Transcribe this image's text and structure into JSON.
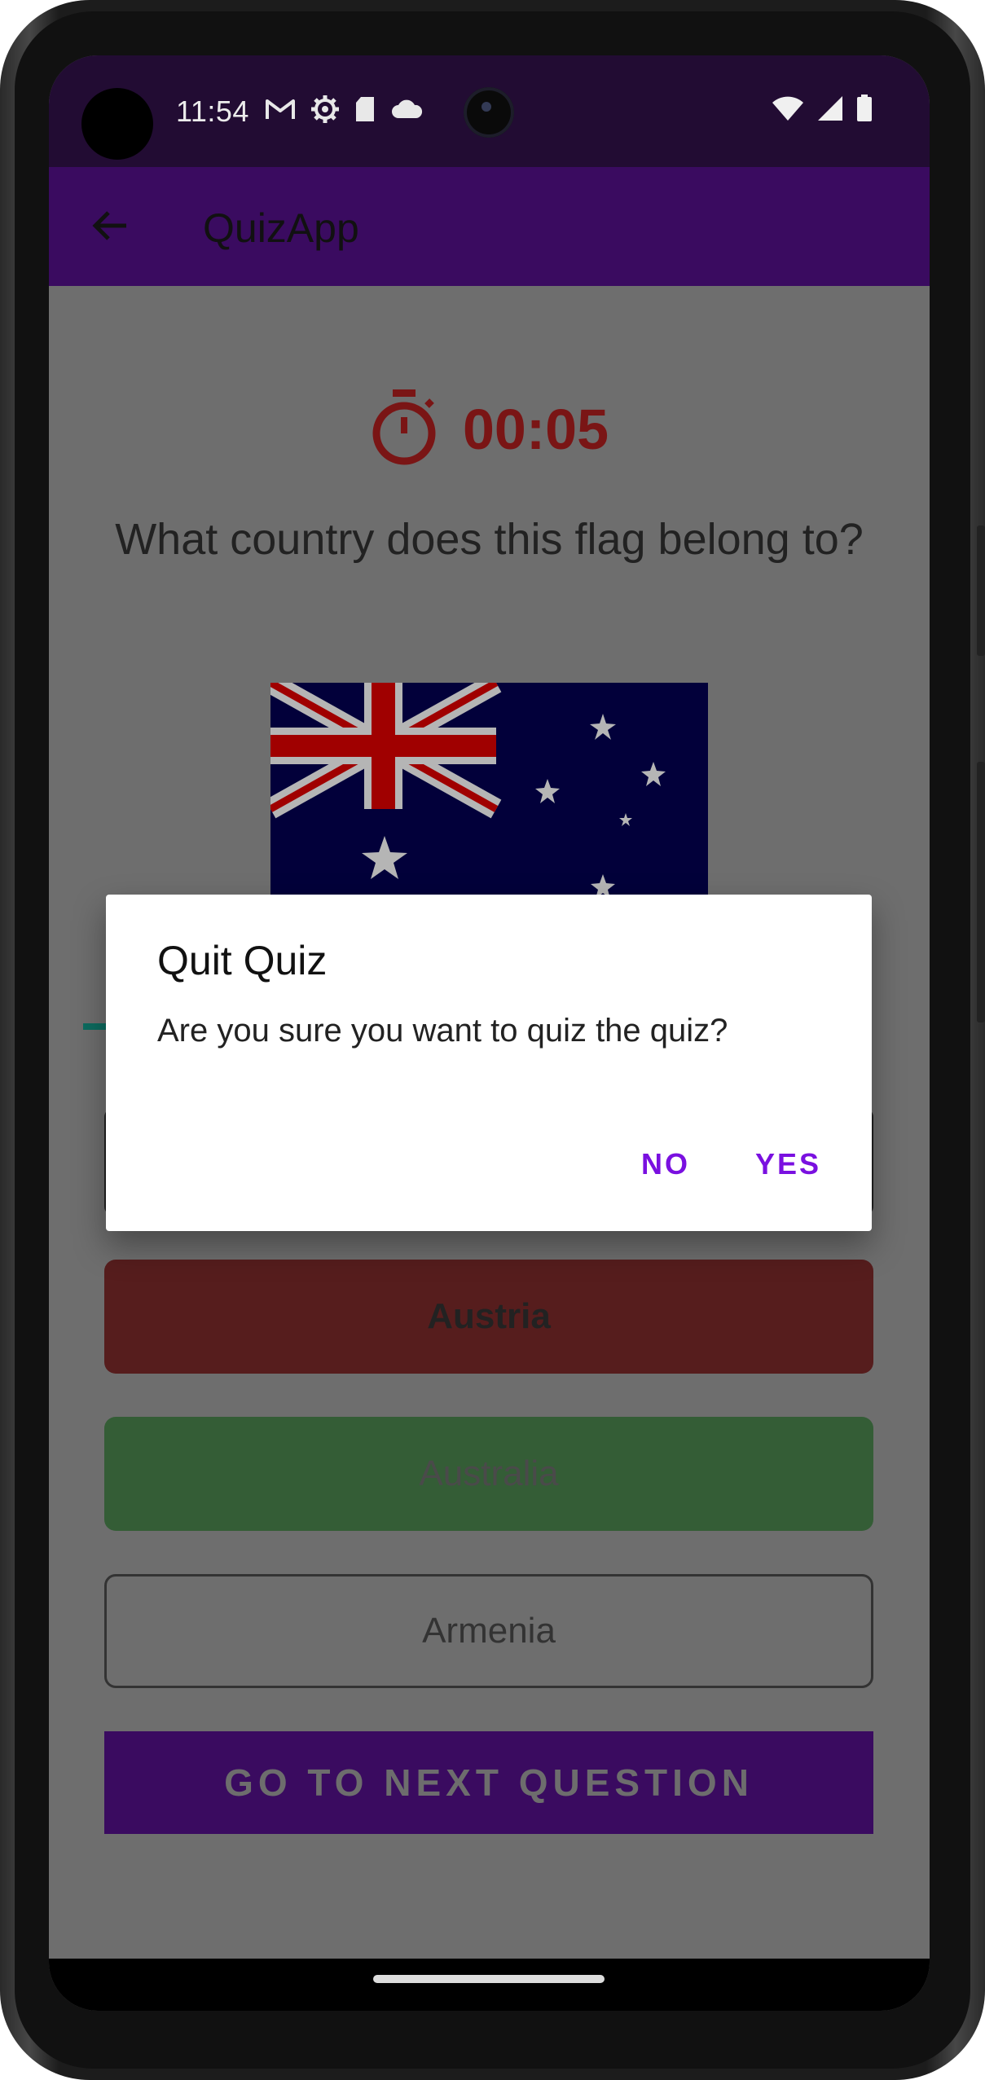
{
  "status_bar": {
    "time": "11:54",
    "icons_left": [
      "gmail-icon",
      "settings-icon",
      "sd-card-icon",
      "cloud-icon"
    ],
    "icons_right": [
      "wifi-icon",
      "signal-icon",
      "battery-icon"
    ]
  },
  "app_bar": {
    "title": "QuizApp",
    "back_icon": "arrow-back-icon"
  },
  "quiz": {
    "timer": "00:05",
    "timer_icon": "stopwatch-icon",
    "question": "What country does this flag belong to?",
    "flag_image": "australia-flag",
    "answers": [
      "Austria",
      "Australia",
      "Armenia"
    ],
    "next_button": "GO TO NEXT QUESTION"
  },
  "dialog": {
    "title": "Quit Quiz",
    "message": "Are you sure you want to quiz the quiz?",
    "no_label": "NO",
    "yes_label": "YES"
  },
  "colors": {
    "status_bar": "#220c33",
    "app_bar": "#3a0b60",
    "timer": "#7a1515",
    "answer_wrong": "#561d1d",
    "answer_correct": "#345d36",
    "dialog_action": "#7a10e0"
  }
}
